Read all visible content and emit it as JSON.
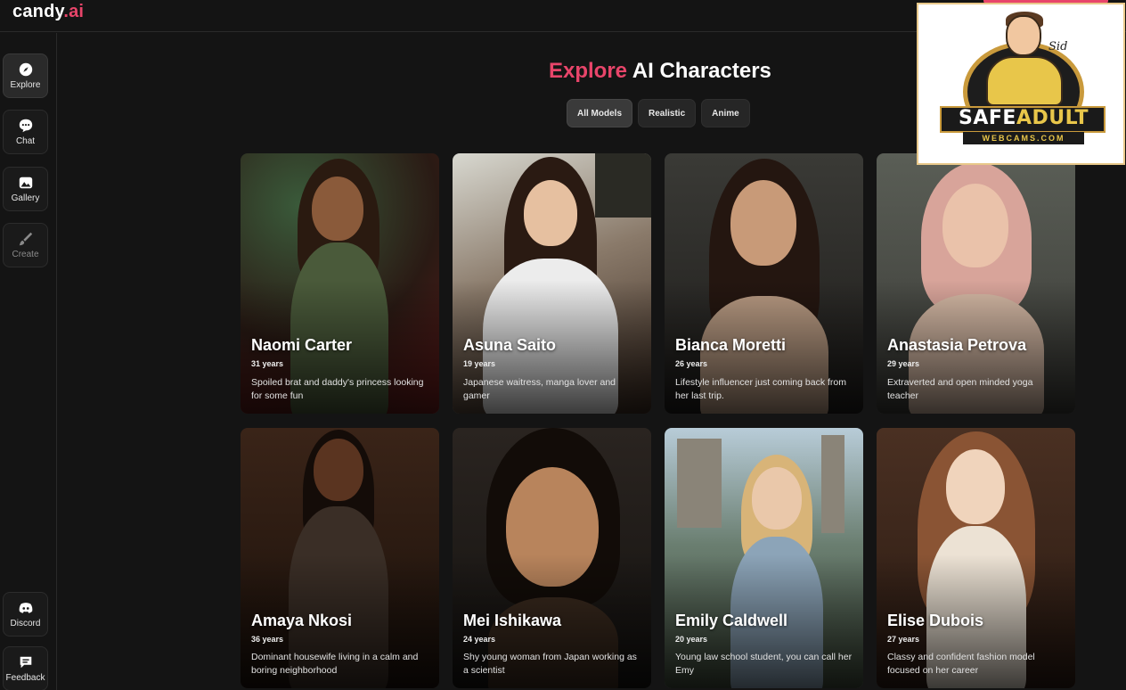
{
  "app": {
    "logo_main": "candy",
    "logo_dot": ".ai"
  },
  "sidebar": {
    "items": [
      {
        "label": "Explore",
        "icon": "compass-icon",
        "active": true
      },
      {
        "label": "Chat",
        "icon": "chat-bubble-icon",
        "active": false
      },
      {
        "label": "Gallery",
        "icon": "gallery-icon",
        "active": false
      },
      {
        "label": "Create",
        "icon": "brush-icon",
        "active": false,
        "disabled": true
      }
    ],
    "bottom": [
      {
        "label": "Discord",
        "icon": "discord-icon"
      },
      {
        "label": "Feedback",
        "icon": "feedback-icon"
      }
    ]
  },
  "main": {
    "title_highlight": "Explore",
    "title_rest": " AI Characters",
    "filters": [
      {
        "label": "All Models",
        "active": true
      },
      {
        "label": "Realistic",
        "active": false
      },
      {
        "label": "Anime",
        "active": false
      }
    ],
    "characters": [
      {
        "name": "Naomi Carter",
        "age": "31 years",
        "desc": "Spoiled brat and daddy's princess looking for some fun"
      },
      {
        "name": "Asuna Saito",
        "age": "19 years",
        "desc": "Japanese waitress, manga lover and gamer"
      },
      {
        "name": "Bianca Moretti",
        "age": "26 years",
        "desc": "Lifestyle influencer just coming back from her last trip."
      },
      {
        "name": "Anastasia Petrova",
        "age": "29 years",
        "desc": "Extraverted and open minded yoga teacher"
      },
      {
        "name": "Amaya Nkosi",
        "age": "36 years",
        "desc": "Dominant housewife living in a calm and boring neighborhood"
      },
      {
        "name": "Mei Ishikawa",
        "age": "24 years",
        "desc": "Shy young woman from Japan working as a scientist"
      },
      {
        "name": "Emily Caldwell",
        "age": "20 years",
        "desc": "Young law school student, you can call her Emy"
      },
      {
        "name": "Elise Dubois",
        "age": "27 years",
        "desc": "Classy and confident fashion model focused on her career"
      }
    ]
  },
  "badge": {
    "safe": "SAFE",
    "adult": "ADULT",
    "sub": "WEBCAMS.COM",
    "signature": "Sid"
  },
  "colors": {
    "accent": "#e8456a",
    "background": "#141414",
    "badge_gold": "#c99a3c"
  }
}
